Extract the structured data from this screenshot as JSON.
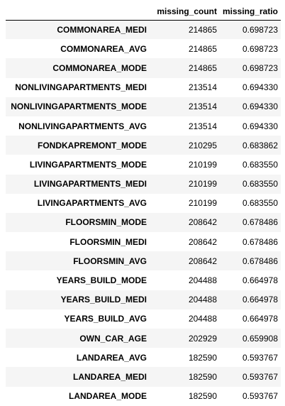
{
  "table": {
    "columns": [
      "",
      "missing_count",
      "missing_ratio"
    ],
    "rows": [
      {
        "index": "COMMONAREA_MEDI",
        "missing_count": "214865",
        "missing_ratio": "0.698723"
      },
      {
        "index": "COMMONAREA_AVG",
        "missing_count": "214865",
        "missing_ratio": "0.698723"
      },
      {
        "index": "COMMONAREA_MODE",
        "missing_count": "214865",
        "missing_ratio": "0.698723"
      },
      {
        "index": "NONLIVINGAPARTMENTS_MEDI",
        "missing_count": "213514",
        "missing_ratio": "0.694330"
      },
      {
        "index": "NONLIVINGAPARTMENTS_MODE",
        "missing_count": "213514",
        "missing_ratio": "0.694330"
      },
      {
        "index": "NONLIVINGAPARTMENTS_AVG",
        "missing_count": "213514",
        "missing_ratio": "0.694330"
      },
      {
        "index": "FONDKAPREMONT_MODE",
        "missing_count": "210295",
        "missing_ratio": "0.683862"
      },
      {
        "index": "LIVINGAPARTMENTS_MODE",
        "missing_count": "210199",
        "missing_ratio": "0.683550"
      },
      {
        "index": "LIVINGAPARTMENTS_MEDI",
        "missing_count": "210199",
        "missing_ratio": "0.683550"
      },
      {
        "index": "LIVINGAPARTMENTS_AVG",
        "missing_count": "210199",
        "missing_ratio": "0.683550"
      },
      {
        "index": "FLOORSMIN_MODE",
        "missing_count": "208642",
        "missing_ratio": "0.678486"
      },
      {
        "index": "FLOORSMIN_MEDI",
        "missing_count": "208642",
        "missing_ratio": "0.678486"
      },
      {
        "index": "FLOORSMIN_AVG",
        "missing_count": "208642",
        "missing_ratio": "0.678486"
      },
      {
        "index": "YEARS_BUILD_MODE",
        "missing_count": "204488",
        "missing_ratio": "0.664978"
      },
      {
        "index": "YEARS_BUILD_MEDI",
        "missing_count": "204488",
        "missing_ratio": "0.664978"
      },
      {
        "index": "YEARS_BUILD_AVG",
        "missing_count": "204488",
        "missing_ratio": "0.664978"
      },
      {
        "index": "OWN_CAR_AGE",
        "missing_count": "202929",
        "missing_ratio": "0.659908"
      },
      {
        "index": "LANDAREA_AVG",
        "missing_count": "182590",
        "missing_ratio": "0.593767"
      },
      {
        "index": "LANDAREA_MEDI",
        "missing_count": "182590",
        "missing_ratio": "0.593767"
      },
      {
        "index": "LANDAREA_MODE",
        "missing_count": "182590",
        "missing_ratio": "0.593767"
      }
    ]
  }
}
